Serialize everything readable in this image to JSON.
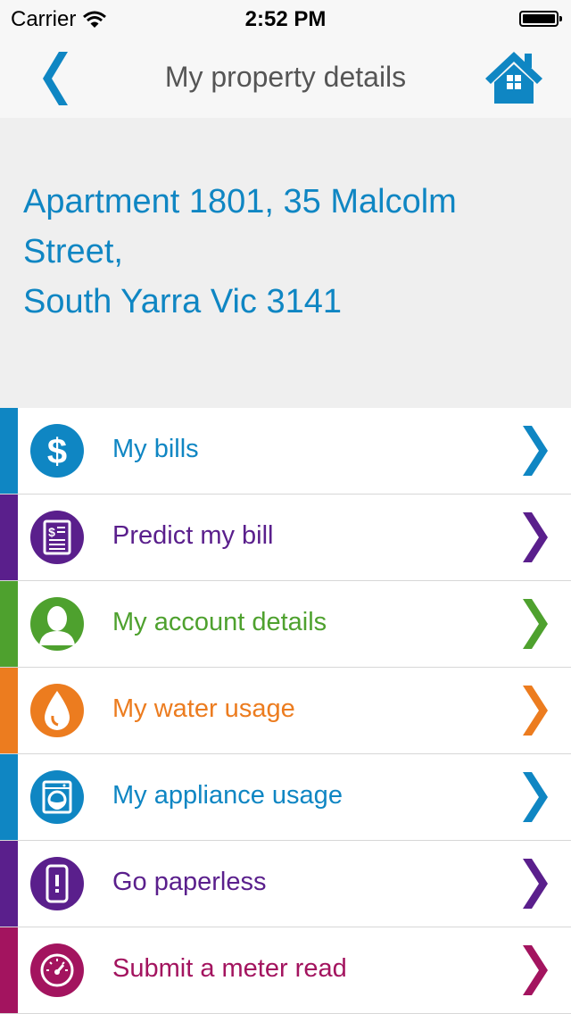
{
  "status_bar": {
    "carrier": "Carrier",
    "time": "2:52 PM"
  },
  "nav": {
    "title": "My property details",
    "accent_color": "#0f86c3"
  },
  "property": {
    "address_line1": "Apartment 1801, 35 Malcolm",
    "address_line2": "Street,",
    "address_line3": "South Yarra Vic 3141",
    "color": "#0f86c3"
  },
  "menu": {
    "items": [
      {
        "label": "My bills",
        "icon": "dollar-icon",
        "color": "#0f86c3"
      },
      {
        "label": "Predict my bill",
        "icon": "bill-document-icon",
        "color": "#5a1f8c"
      },
      {
        "label": "My account details",
        "icon": "person-icon",
        "color": "#4ea12e"
      },
      {
        "label": "My water usage",
        "icon": "water-drop-icon",
        "color": "#ec7c1f"
      },
      {
        "label": "My appliance usage",
        "icon": "washing-machine-icon",
        "color": "#0f86c3"
      },
      {
        "label": "Go paperless",
        "icon": "mobile-phone-icon",
        "color": "#5a1f8c"
      },
      {
        "label": "Submit a meter read",
        "icon": "meter-gauge-icon",
        "color": "#a3145f"
      }
    ]
  }
}
